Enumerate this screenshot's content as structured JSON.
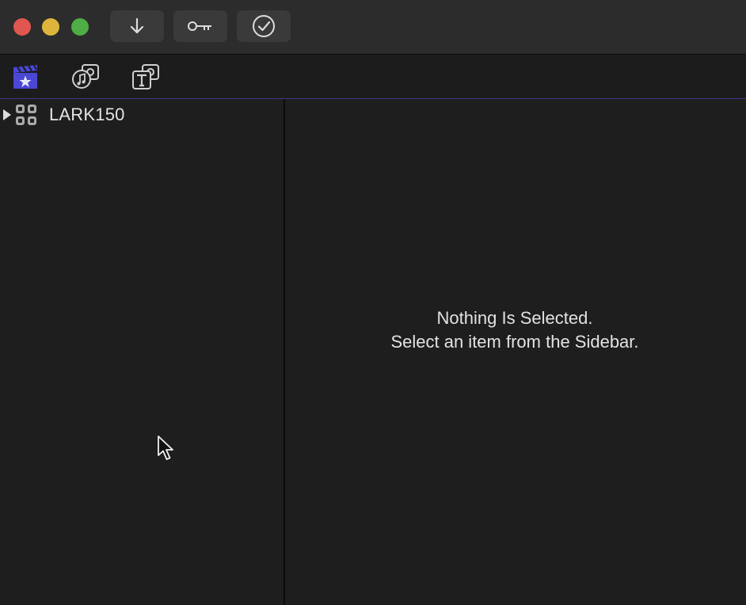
{
  "window": {
    "traffic_lights": {
      "close": "#e0574f",
      "minimize": "#dcb53a",
      "maximize": "#4fae43"
    }
  },
  "toolbar": {
    "buttons": [
      {
        "icon": "download-arrow-icon"
      },
      {
        "icon": "key-icon"
      },
      {
        "icon": "checkmark-circle-icon"
      }
    ]
  },
  "tabs": [
    {
      "icon": "movie-clapper-icon",
      "selected": true,
      "accent": "#4b47d6"
    },
    {
      "icon": "music-photo-icon",
      "selected": false
    },
    {
      "icon": "text-title-icon",
      "selected": false
    }
  ],
  "sidebar": {
    "items": [
      {
        "label": "LARK150",
        "icon": "grid-library-icon",
        "expanded": false
      }
    ]
  },
  "main": {
    "empty_state": {
      "line1": "Nothing Is Selected.",
      "line2": "Select an item from the Sidebar."
    }
  }
}
